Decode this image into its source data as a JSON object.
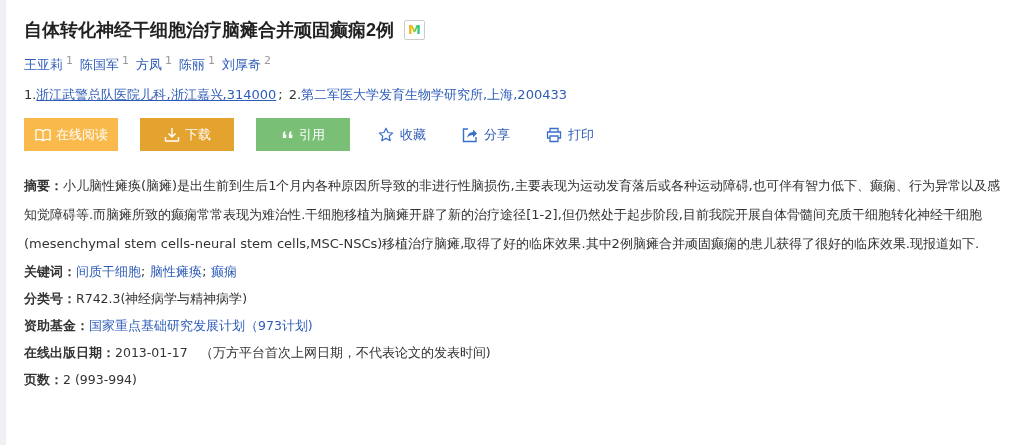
{
  "title": "自体转化神经干细胞治疗脑瘫合并顽固癫痫2例",
  "title_badge": "M",
  "authors": [
    {
      "name": "王亚莉",
      "sup": "1"
    },
    {
      "name": "陈国军",
      "sup": "1"
    },
    {
      "name": "方凤",
      "sup": "1"
    },
    {
      "name": "陈丽",
      "sup": "1"
    },
    {
      "name": "刘厚奇",
      "sup": "2"
    }
  ],
  "affiliations": [
    {
      "number": "1.",
      "name": "浙江武警总队医院儿科,浙江嘉兴,314000",
      "underlined": true,
      "separator": ";"
    },
    {
      "number": "2.",
      "name": "第二军医大学发育生物学研究所,上海,200433",
      "underlined": false
    }
  ],
  "actions": [
    {
      "label": "在线阅读",
      "kind": "read",
      "color": "#f9b94b"
    },
    {
      "label": "下载",
      "kind": "download",
      "color": "#e4a32f"
    },
    {
      "label": "引用",
      "kind": "cite",
      "color": "#79bf76"
    },
    {
      "label": "收藏",
      "kind": "collect"
    },
    {
      "label": "分享",
      "kind": "share"
    },
    {
      "label": "打印",
      "kind": "print"
    }
  ],
  "abstract": {
    "label": "摘要：",
    "text": "小儿脑性瘫痪(脑瘫)是出生前到生后1个月内各种原因所导致的非进行性脑损伤,主要表现为运动发育落后或各种运动障碍,也可伴有智力低下、癫痫、行为异常以及感知觉障碍等.而脑瘫所致的癫痫常常表现为难治性.干细胞移植为脑瘫开辟了新的治疗途径[1-2],但仍然处于起步阶段,目前我院开展自体骨髓间充质干细胞转化神经干细胞(mesenchymal stem cells-neural stem cells,MSC-NSCs)移植治疗脑瘫,取得了好的临床效果.其中2例脑瘫合并顽固癫痫的患儿获得了很好的临床效果.现报道如下."
  },
  "meta": [
    {
      "label": "关键词：",
      "kind": "links",
      "values": [
        "间质干细胞",
        "脑性瘫痪",
        "癫痫"
      ],
      "separator": ";"
    },
    {
      "label": "分类号：",
      "kind": "text",
      "value": "R742.3(神经病学与精神病学)"
    },
    {
      "label": "资助基金：",
      "kind": "link",
      "value": "国家重点基础研究发展计划（973计划)"
    },
    {
      "label": "在线出版日期：",
      "kind": "date",
      "value": "2013-01-17",
      "note": "（万方平台首次上网日期，不代表论文的发表时间)"
    },
    {
      "label": "页数：",
      "kind": "text",
      "value": "2 (993-994)"
    }
  ]
}
